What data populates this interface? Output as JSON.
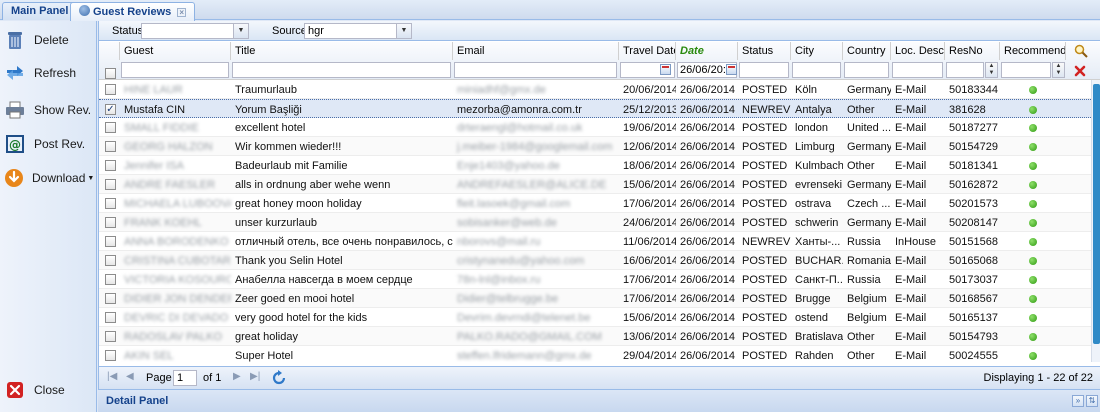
{
  "tabs": [
    {
      "label": "Main Panel",
      "active": false
    },
    {
      "label": "Guest Reviews",
      "active": true
    }
  ],
  "sidebar": {
    "items": [
      {
        "label": "Delete",
        "icon": "trash-icon"
      },
      {
        "label": "Refresh",
        "icon": "refresh-arrows-icon"
      },
      {
        "label": "Show Rev.",
        "icon": "printer-icon"
      },
      {
        "label": "Post Rev.",
        "icon": "post-at-icon"
      },
      {
        "label": "Download",
        "icon": "download-icon"
      }
    ],
    "close_label": "Close"
  },
  "filters": {
    "status_label": "Status",
    "status_value": "",
    "source_label": "Source",
    "source_value": "hgr"
  },
  "columns": [
    "Guest",
    "Title",
    "Email",
    "Travel Date",
    "Date",
    "Status",
    "City",
    "Country",
    "Loc. Desc",
    "ResNo",
    "Recommend"
  ],
  "header_filters": {
    "date_value": "26/06/20:"
  },
  "rows": [
    {
      "checked": false,
      "guest": "HINE LAUR",
      "title": "Traumurlaub",
      "email": "miniadhf@gmx.de",
      "travel_date": "20/06/2014",
      "date": "26/06/2014",
      "status": "POSTED",
      "city": "Köln",
      "country": "Germany",
      "loc": "E-Mail",
      "resno": "50183344",
      "recommend": true,
      "blur_guest": true,
      "blur_email": true
    },
    {
      "checked": true,
      "guest": "Mustafa CIN",
      "title": "Yorum Başliği",
      "email": "mezorba@amonra.com.tr",
      "travel_date": "25/12/2013",
      "date": "26/06/2014",
      "status": "NEWREV",
      "city": "Antalya",
      "country": "Other",
      "loc": "E-Mail",
      "resno": "381628",
      "recommend": true,
      "blur_guest": false,
      "blur_email": false
    },
    {
      "checked": false,
      "guest": "SMALL FIDDIE",
      "title": "excellent hotel",
      "email": "drteraengl@hotmail.co.uk",
      "travel_date": "19/06/2014",
      "date": "26/06/2014",
      "status": "POSTED",
      "city": "london",
      "country": "United ...",
      "loc": "E-Mail",
      "resno": "50187277",
      "recommend": true,
      "blur_guest": true,
      "blur_email": true
    },
    {
      "checked": false,
      "guest": "GEORG HALZON",
      "title": "Wir kommen wieder!!!",
      "email": "j.meiber-1984@googlemail.com",
      "travel_date": "12/06/2014",
      "date": "26/06/2014",
      "status": "POSTED",
      "city": "Limburg",
      "country": "Germany",
      "loc": "E-Mail",
      "resno": "50154729",
      "recommend": true,
      "blur_guest": true,
      "blur_email": true
    },
    {
      "checked": false,
      "guest": "Jennifer ISA",
      "title": "Badeurlaub mit Familie",
      "email": "Enje1403@yahoo.de",
      "travel_date": "18/06/2014",
      "date": "26/06/2014",
      "status": "POSTED",
      "city": "Kulmbach",
      "country": "Other",
      "loc": "E-Mail",
      "resno": "50181341",
      "recommend": true,
      "blur_guest": true,
      "blur_email": true
    },
    {
      "checked": false,
      "guest": "ANDRE FAESLER",
      "title": "alls in ordnung aber wehe wenn",
      "email": "ANDREFAESLER@ALICE.DE",
      "travel_date": "15/06/2014",
      "date": "26/06/2014",
      "status": "POSTED",
      "city": "evrenseki",
      "country": "Germany",
      "loc": "E-Mail",
      "resno": "50162872",
      "recommend": true,
      "blur_guest": true,
      "blur_email": true
    },
    {
      "checked": false,
      "guest": "MICHAELA LUBOOVA",
      "title": "great honey moon holiday",
      "email": "fleit.lasoek@gmail.com",
      "travel_date": "17/06/2014",
      "date": "26/06/2014",
      "status": "POSTED",
      "city": "ostrava",
      "country": "Czech ...",
      "loc": "E-Mail",
      "resno": "50201573",
      "recommend": true,
      "blur_guest": true,
      "blur_email": true
    },
    {
      "checked": false,
      "guest": "FRANK KOEHL",
      "title": "unser kurzurlaub",
      "email": "sobisanker@web.de",
      "travel_date": "24/06/2014",
      "date": "26/06/2014",
      "status": "POSTED",
      "city": "schwerin",
      "country": "Germany",
      "loc": "E-Mail",
      "resno": "50208147",
      "recommend": true,
      "blur_guest": true,
      "blur_email": true
    },
    {
      "checked": false,
      "guest": "ANNA BORODENKO",
      "title": "отличный отель, все очень понравилось, спасиб...",
      "email": "nborovs@mail.ru",
      "travel_date": "11/06/2014",
      "date": "26/06/2014",
      "status": "NEWREV",
      "city": "Ханты-...",
      "country": "Russia",
      "loc": "InHouse",
      "resno": "50151568",
      "recommend": true,
      "blur_guest": true,
      "blur_email": true
    },
    {
      "checked": false,
      "guest": "CRISTINA CUBOTARIU",
      "title": "Thank you Selin Hotel",
      "email": "cristynanedu@yahoo.com",
      "travel_date": "16/06/2014",
      "date": "26/06/2014",
      "status": "POSTED",
      "city": "BUCHAR...",
      "country": "Romania",
      "loc": "E-Mail",
      "resno": "50165068",
      "recommend": true,
      "blur_guest": true,
      "blur_email": true
    },
    {
      "checked": false,
      "guest": "VICTORIA KOSOUROVA",
      "title": "Анабелла навсегда в моем сердце",
      "email": "78n-lnl@inbox.ru",
      "travel_date": "17/06/2014",
      "date": "26/06/2014",
      "status": "POSTED",
      "city": "Санкт-П...",
      "country": "Russia",
      "loc": "E-Mail",
      "resno": "50173037",
      "recommend": true,
      "blur_guest": true,
      "blur_email": true
    },
    {
      "checked": false,
      "guest": "DIDIER JON DENDERS",
      "title": "Zeer goed en mooi hotel",
      "email": "Didier@telbrugge.be",
      "travel_date": "17/06/2014",
      "date": "26/06/2014",
      "status": "POSTED",
      "city": "Brugge",
      "country": "Belgium",
      "loc": "E-Mail",
      "resno": "50168567",
      "recommend": true,
      "blur_guest": true,
      "blur_email": true
    },
    {
      "checked": false,
      "guest": "DEVRIC DI DEVADO",
      "title": "very good hotel for the kids",
      "email": "Devrim.devrndi@telenet.be",
      "travel_date": "15/06/2014",
      "date": "26/06/2014",
      "status": "POSTED",
      "city": "ostend",
      "country": "Belgium",
      "loc": "E-Mail",
      "resno": "50165137",
      "recommend": true,
      "blur_guest": true,
      "blur_email": true
    },
    {
      "checked": false,
      "guest": "RADOSLAV PALKO",
      "title": "great holiday",
      "email": "PALKO.RADO@GMAIL.COM",
      "travel_date": "13/06/2014",
      "date": "26/06/2014",
      "status": "POSTED",
      "city": "Bratislava",
      "country": "Other",
      "loc": "E-Mail",
      "resno": "50154793",
      "recommend": true,
      "blur_guest": true,
      "blur_email": true
    },
    {
      "checked": false,
      "guest": "AKIN SEL",
      "title": "Super Hotel",
      "email": "steffen.lfridemann@gmx.de",
      "travel_date": "29/04/2014",
      "date": "26/06/2014",
      "status": "POSTED",
      "city": "Rahden",
      "country": "Other",
      "loc": "E-Mail",
      "resno": "50024555",
      "recommend": true,
      "blur_guest": true,
      "blur_email": true
    }
  ],
  "pager": {
    "page_label": "Page",
    "page_value": "1",
    "of_label": "of 1",
    "display_text": "Displaying 1 - 22 of 22"
  },
  "detail_panel": {
    "title": "Detail Panel"
  },
  "colors": {
    "accent": "#15428b",
    "border": "#99bbe8",
    "panel_bg": "#dfe8f6",
    "sorted_header": "#2a8a0f",
    "recommend_green": "#2f9a12",
    "clear_red": "#d22222"
  }
}
